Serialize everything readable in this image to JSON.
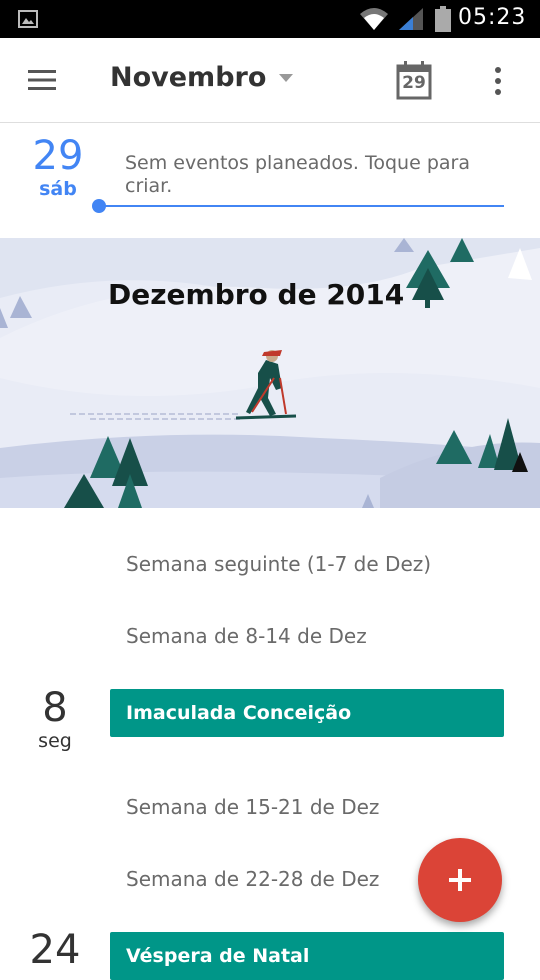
{
  "status_bar": {
    "time": "05:23",
    "icons": [
      "image-notification-icon",
      "wifi-icon",
      "signal-icon",
      "battery-icon"
    ]
  },
  "toolbar": {
    "month": "Novembro",
    "today_day": "29",
    "icons": [
      "menu-icon",
      "dropdown-arrow-icon",
      "calendar-today-icon",
      "more-vert-icon"
    ]
  },
  "today": {
    "day": "29",
    "weekday": "sáb",
    "no_events_text": "Sem eventos planeados. Toque para criar."
  },
  "banner": {
    "title": "Dezembro de 2014"
  },
  "agenda": {
    "week_1": "Semana seguinte (1-7 de Dez)",
    "week_2": "Semana de 8-14 de Dez",
    "day_8": {
      "day": "8",
      "weekday": "seg",
      "event": "Imaculada Conceição"
    },
    "week_3": "Semana de 15-21 de Dez",
    "week_4": "Semana de 22-28 de Dez",
    "day_24": {
      "day": "24",
      "event": "Véspera de Natal"
    }
  },
  "colors": {
    "accent_blue": "#4285f4",
    "event_teal": "#009688",
    "fab_red": "#db4437",
    "status_bar": "#000000"
  },
  "fab": {
    "icon": "plus-icon"
  }
}
